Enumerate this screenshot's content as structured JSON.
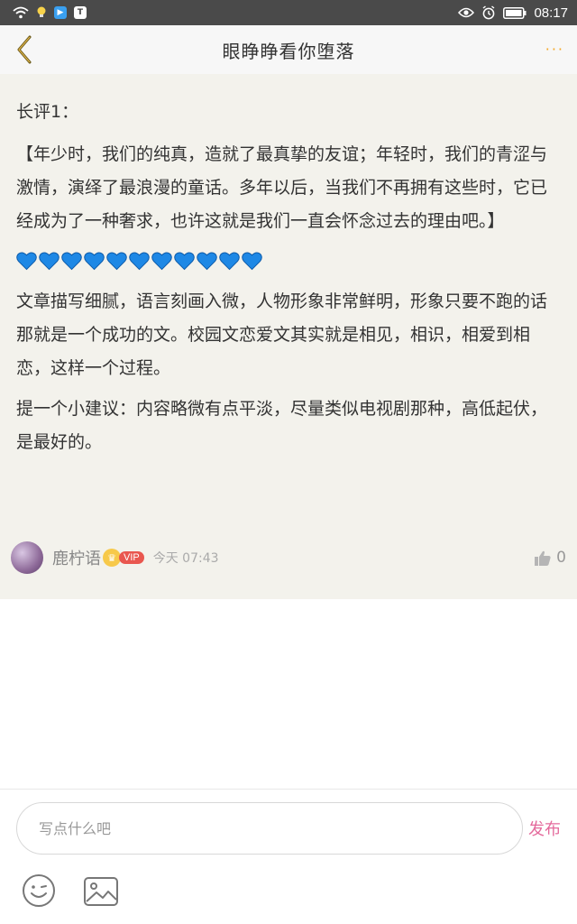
{
  "status_bar": {
    "time": "08:17",
    "icons": [
      "wifi-icon",
      "bulb-icon",
      "app-icon",
      "app-icon-2",
      "eye-icon",
      "alarm-icon",
      "battery-icon"
    ]
  },
  "header": {
    "title": "眼睁睁看你堕落",
    "back_icon": "chevron-left-icon",
    "more_label": "···"
  },
  "review": {
    "heading": "长评1：",
    "quote": "【年少时，我们的纯真，造就了最真挚的友谊；年轻时，我们的青涩与激情，演绎了最浪漫的童话。多年以后，当我们不再拥有这些时，它已经成为了一种奢求，也许这就是我们一直会怀念过去的理由吧。】",
    "hearts_count": 11,
    "body": "文章描写细腻，语言刻画入微，人物形象非常鲜明，形象只要不跑的话那就是一个成功的文。校园文恋爱文其实就是相见，相识，相爱到相恋，这样一个过程。",
    "suggestion": "提一个小建议：内容略微有点平淡，尽量类似电视剧那种，高低起伏，是最好的。",
    "author": {
      "name": "鹿柠语",
      "badge": "VIP",
      "time": "今天 07:43",
      "likes": "0"
    }
  },
  "composer": {
    "placeholder": "写点什么吧",
    "send_label": "发布"
  },
  "colors": {
    "accent": "#f5a623",
    "send": "#e46a9c",
    "vip": "#e9574f",
    "heart": "#1e88e5",
    "card_bg": "#f3f2ec"
  }
}
